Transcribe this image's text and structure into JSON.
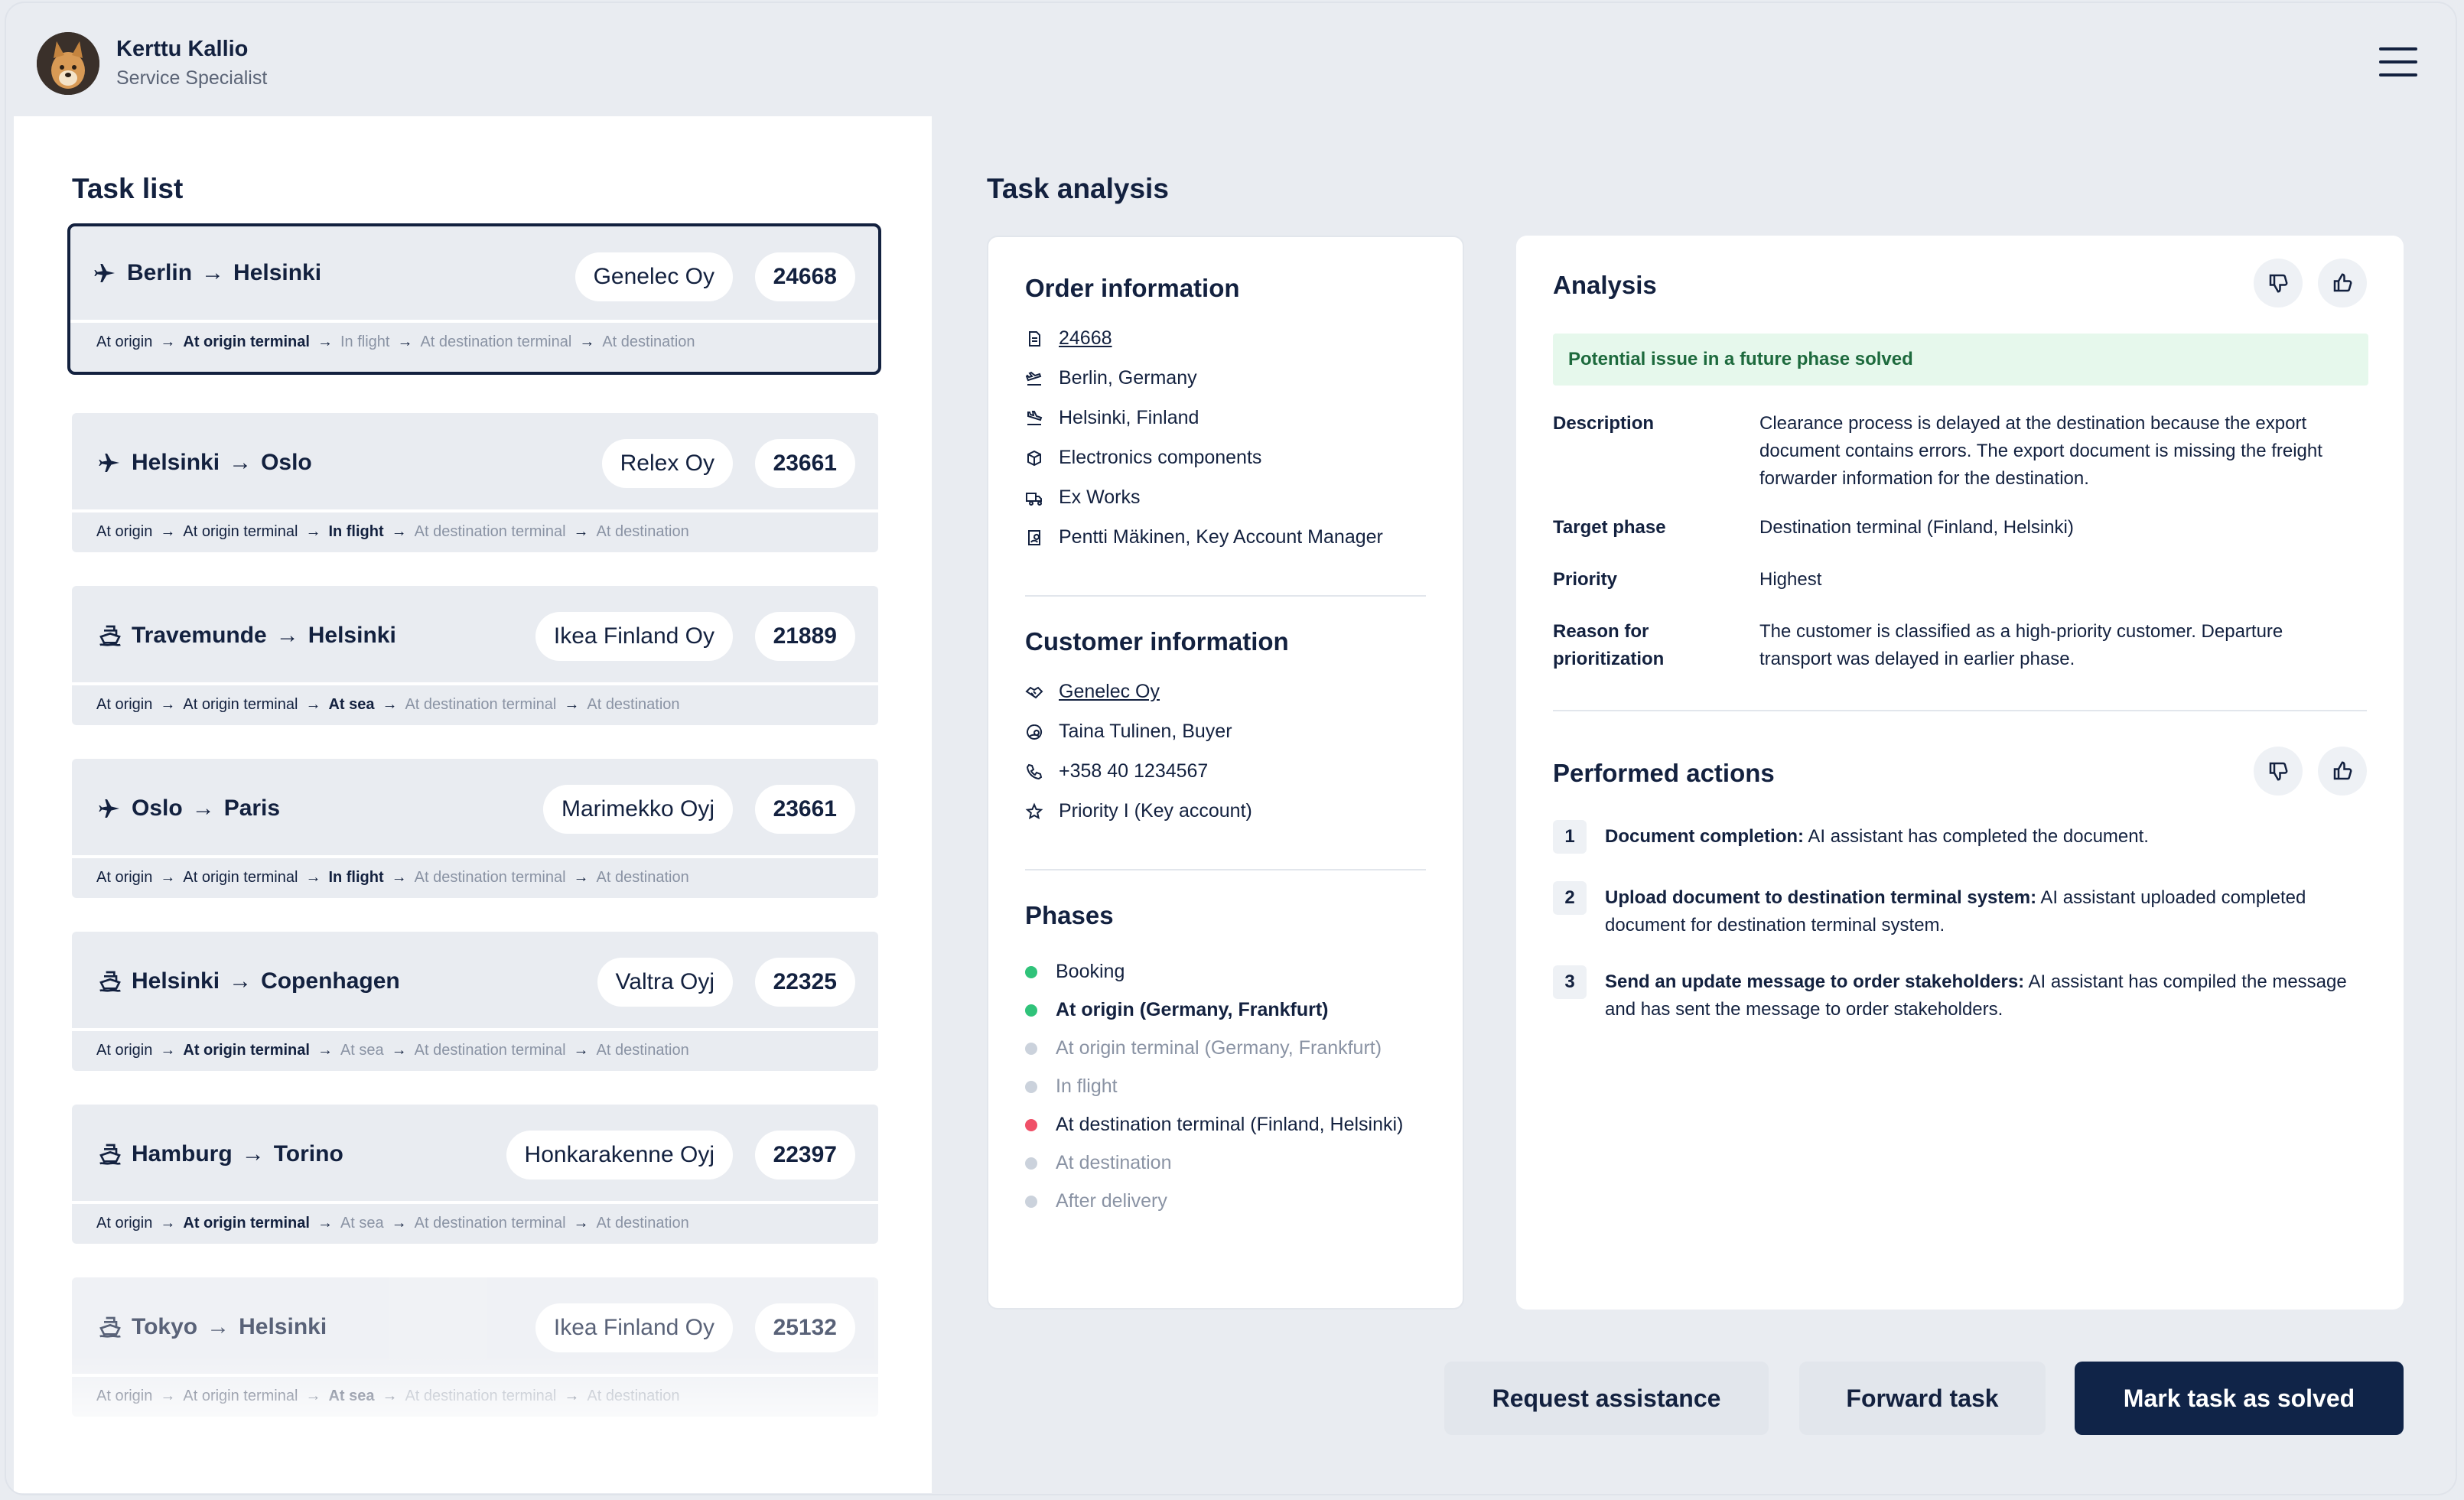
{
  "user": {
    "name": "Kerttu Kallio",
    "role": "Service Specialist"
  },
  "task_list": {
    "title": "Task list",
    "tasks": [
      {
        "mode": "plane",
        "from": "Berlin",
        "to": "Helsinki",
        "company": "Genelec Oy",
        "number": "24668",
        "phases": [
          "At origin",
          "At origin terminal",
          "In flight",
          "At destination terminal",
          "At destination"
        ],
        "current": 1
      },
      {
        "mode": "plane",
        "from": "Helsinki",
        "to": "Oslo",
        "company": "Relex Oy",
        "number": "23661",
        "phases": [
          "At origin",
          "At origin terminal",
          "In flight",
          "At destination terminal",
          "At destination"
        ],
        "current": 2
      },
      {
        "mode": "ship",
        "from": "Travemunde",
        "to": "Helsinki",
        "company": "Ikea Finland Oy",
        "number": "21889",
        "phases": [
          "At origin",
          "At origin terminal",
          "At sea",
          "At destination terminal",
          "At destination"
        ],
        "current": 2
      },
      {
        "mode": "plane",
        "from": "Oslo",
        "to": "Paris",
        "company": "Marimekko Oyj",
        "number": "23661",
        "phases": [
          "At origin",
          "At origin terminal",
          "In flight",
          "At destination terminal",
          "At destination"
        ],
        "current": 2
      },
      {
        "mode": "ship",
        "from": "Helsinki",
        "to": "Copenhagen",
        "company": "Valtra Oyj",
        "number": "22325",
        "phases": [
          "At origin",
          "At origin terminal",
          "At sea",
          "At destination terminal",
          "At destination"
        ],
        "current": 1
      },
      {
        "mode": "ship",
        "from": "Hamburg",
        "to": "Torino",
        "company": "Honkarakenne Oyj",
        "number": "22397",
        "phases": [
          "At origin",
          "At origin terminal",
          "At sea",
          "At destination terminal",
          "At destination"
        ],
        "current": 1
      },
      {
        "mode": "ship",
        "from": "Tokyo",
        "to": "Helsinki",
        "company": "Ikea Finland Oy",
        "number": "25132",
        "phases": [
          "At origin",
          "At origin terminal",
          "At sea",
          "At destination terminal",
          "At destination"
        ],
        "current": 2
      }
    ]
  },
  "analysis_title": "Task analysis",
  "order": {
    "title": "Order information",
    "number": "24668",
    "origin": "Berlin, Germany",
    "destination": "Helsinki, Finland",
    "goods": "Electronics components",
    "incoterm": "Ex Works",
    "manager": "Pentti Mäkinen, Key Account Manager"
  },
  "customer": {
    "title": "Customer information",
    "company": "Genelec Oy",
    "contact": "Taina Tulinen, Buyer",
    "phone": "+358 40 1234567",
    "priority": "Priority I (Key account)"
  },
  "phases": {
    "title": "Phases",
    "items": [
      {
        "label": "Booking",
        "status": "done"
      },
      {
        "label": "At origin (Germany, Frankfurt)",
        "status": "current"
      },
      {
        "label": "At origin terminal (Germany, Frankfurt)",
        "status": "pending"
      },
      {
        "label": "In flight",
        "status": "pending"
      },
      {
        "label": "At destination terminal (Finland, Helsinki)",
        "status": "issue"
      },
      {
        "label": "At destination",
        "status": "pending"
      },
      {
        "label": "After delivery",
        "status": "pending"
      }
    ]
  },
  "analysis": {
    "title": "Analysis",
    "badge": "Potential issue in a future phase solved",
    "description_label": "Description",
    "description": "Clearance process is delayed at the destination because the export document contains errors. The export document is missing the freight forwarder information for the destination.",
    "target_label": "Target phase",
    "target": "Destination terminal (Finland, Helsinki)",
    "priority_label": "Priority",
    "priority": "Highest",
    "reason_label": "Reason for prioritization",
    "reason": "The customer is classified as a high-priority customer. Departure transport was delayed in earlier phase."
  },
  "actions": {
    "title": "Performed actions",
    "items": [
      {
        "num": "1",
        "title": "Document completion:",
        "text": " AI assistant has completed the document."
      },
      {
        "num": "2",
        "title": "Upload document to destination terminal system:",
        "text": " AI assistant uploaded completed document for destination terminal system."
      },
      {
        "num": "3",
        "title": "Send an update message to order stakeholders:",
        "text": " AI assistant has compiled the message and has sent the message to order stakeholders."
      }
    ]
  },
  "buttons": {
    "request": "Request assistance",
    "forward": "Forward task",
    "solve": "Mark task as solved"
  },
  "colors": {
    "navy": "#102448",
    "done": "#30c37a",
    "issue": "#f05068",
    "pending": "#cbd2dc",
    "badge_bg": "#e6f8ec"
  }
}
